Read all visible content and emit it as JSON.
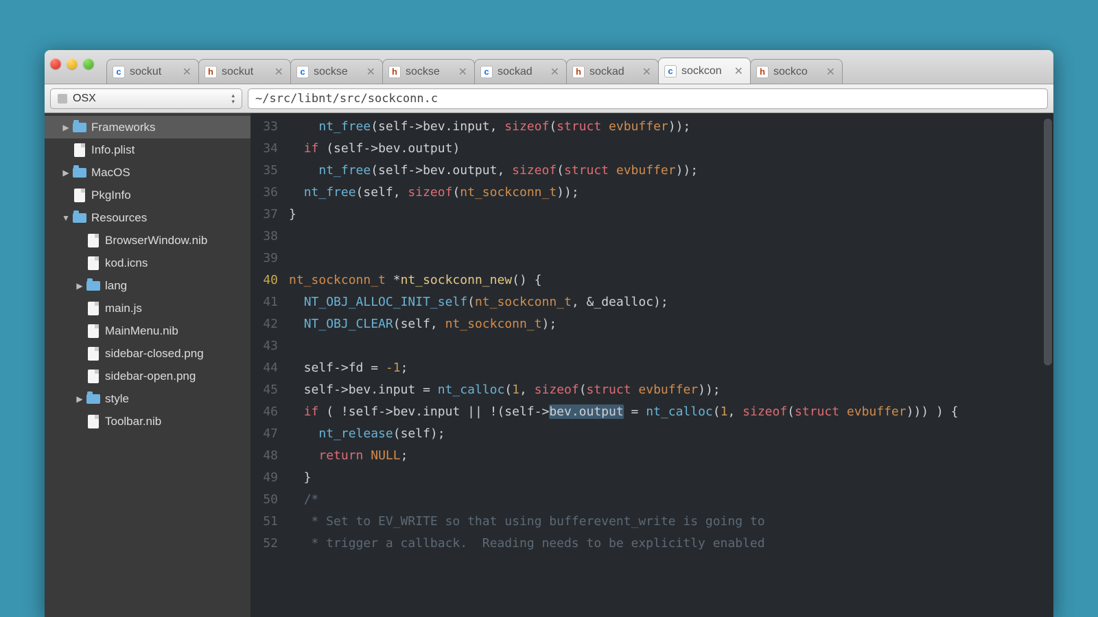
{
  "toolbar": {
    "volume_label": "OSX",
    "path": "~/src/libnt/src/sockconn.c"
  },
  "tabs": [
    {
      "icon": "c",
      "label": "sockut",
      "active": false
    },
    {
      "icon": "h",
      "label": "sockut",
      "active": false
    },
    {
      "icon": "c",
      "label": "sockse",
      "active": false
    },
    {
      "icon": "h",
      "label": "sockse",
      "active": false
    },
    {
      "icon": "c",
      "label": "sockad",
      "active": false
    },
    {
      "icon": "h",
      "label": "sockad",
      "active": false
    },
    {
      "icon": "c",
      "label": "sockcon",
      "active": true
    },
    {
      "icon": "h",
      "label": "sockco",
      "active": false
    }
  ],
  "sidebar": [
    {
      "type": "folder",
      "label": "Frameworks",
      "indent": 1,
      "expand": "closed",
      "selected": true
    },
    {
      "type": "file",
      "label": "Info.plist",
      "indent": 1
    },
    {
      "type": "folder",
      "label": "MacOS",
      "indent": 1,
      "expand": "closed"
    },
    {
      "type": "file",
      "label": "PkgInfo",
      "indent": 1
    },
    {
      "type": "folder",
      "label": "Resources",
      "indent": 1,
      "expand": "open"
    },
    {
      "type": "file",
      "label": "BrowserWindow.nib",
      "indent": 2
    },
    {
      "type": "file",
      "label": "kod.icns",
      "indent": 2
    },
    {
      "type": "folder",
      "label": "lang",
      "indent": 2,
      "expand": "closed"
    },
    {
      "type": "file",
      "label": "main.js",
      "indent": 2
    },
    {
      "type": "file",
      "label": "MainMenu.nib",
      "indent": 2
    },
    {
      "type": "file",
      "label": "sidebar-closed.png",
      "indent": 2
    },
    {
      "type": "file",
      "label": "sidebar-open.png",
      "indent": 2
    },
    {
      "type": "folder",
      "label": "style",
      "indent": 2,
      "expand": "closed"
    },
    {
      "type": "file",
      "label": "Toolbar.nib",
      "indent": 2
    }
  ],
  "editor": {
    "first_line": 33,
    "current_line": 40,
    "lines": [
      {
        "n": 33,
        "html": "    <span class='c-fn'>nt_free</span>(self-&gt;bev.input, <span class='c-kw'>sizeof</span>(<span class='c-kw'>struct</span> <span class='c-type'>evbuffer</span>));"
      },
      {
        "n": 34,
        "html": "  <span class='c-kw'>if</span> (self-&gt;bev.output)"
      },
      {
        "n": 35,
        "html": "    <span class='c-fn'>nt_free</span>(self-&gt;bev.output, <span class='c-kw'>sizeof</span>(<span class='c-kw'>struct</span> <span class='c-type'>evbuffer</span>));"
      },
      {
        "n": 36,
        "html": "  <span class='c-fn'>nt_free</span>(self, <span class='c-kw'>sizeof</span>(<span class='c-type'>nt_sockconn_t</span>));"
      },
      {
        "n": 37,
        "html": "}"
      },
      {
        "n": 38,
        "html": ""
      },
      {
        "n": 39,
        "html": ""
      },
      {
        "n": 40,
        "html": "<span class='c-type'>nt_sockconn_t</span> *<span class='c-id'>nt_sockconn_new</span>() {"
      },
      {
        "n": 41,
        "html": "  <span class='c-fn'>NT_OBJ_ALLOC_INIT_self</span>(<span class='c-type'>nt_sockconn_t</span>, &amp;_dealloc);"
      },
      {
        "n": 42,
        "html": "  <span class='c-fn'>NT_OBJ_CLEAR</span>(self, <span class='c-type'>nt_sockconn_t</span>);"
      },
      {
        "n": 43,
        "html": ""
      },
      {
        "n": 44,
        "html": "  self-&gt;fd = <span class='c-num'>-1</span>;"
      },
      {
        "n": 45,
        "html": "  self-&gt;bev.input = <span class='c-fn'>nt_calloc</span>(<span class='c-num'>1</span>, <span class='c-kw'>sizeof</span>(<span class='c-kw'>struct</span> <span class='c-type'>evbuffer</span>));"
      },
      {
        "n": 46,
        "html": "  <span class='c-kw'>if</span> ( !self-&gt;bev.input || !(self-&gt;<span class='hl'>bev.output</span> = <span class='c-fn'>nt_calloc</span>(<span class='c-num'>1</span>, <span class='c-kw'>sizeof</span>(<span class='c-kw'>struct</span> <span class='c-type'>evbuffer</span>))) ) {"
      },
      {
        "n": 47,
        "html": "    <span class='c-fn'>nt_release</span>(self);"
      },
      {
        "n": 48,
        "html": "    <span class='c-kw'>return</span> <span class='c-null'>NULL</span>;"
      },
      {
        "n": 49,
        "html": "  }"
      },
      {
        "n": 50,
        "html": "  <span class='c-cm'>/*</span>"
      },
      {
        "n": 51,
        "html": "<span class='c-cm'>   * Set to EV_WRITE so that using bufferevent_write is going to</span>"
      },
      {
        "n": 52,
        "html": "<span class='c-cm'>   * trigger a callback.  Reading needs to be explicitly enabled</span>"
      }
    ]
  }
}
